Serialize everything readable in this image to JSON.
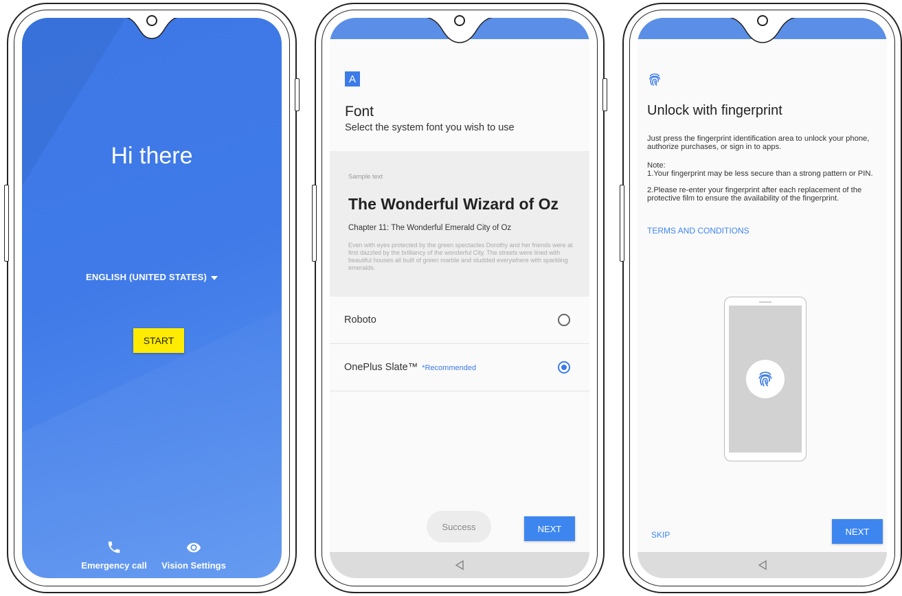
{
  "screen1": {
    "greeting": "Hi there",
    "language": "ENGLISH (UNITED STATES)",
    "start_label": "START",
    "emergency_label": "Emergency call",
    "vision_label": "Vision Settings",
    "icons": [
      "phone-icon",
      "eye-icon",
      "chevron-down-icon"
    ]
  },
  "screen2": {
    "icon_letter": "A",
    "title": "Font",
    "subtitle": "Select the system font you wish to use",
    "sample": {
      "label": "Sample text",
      "title": "The Wonderful Wizard of Oz",
      "chapter": "Chapter 11: The Wonderful Emerald City of Oz",
      "body": "Even with eyes protected by the green spectacles Dorothy and her friends were at first dazzled by the brilliancy of the wonderful City. The streets were lined with beautiful houses all built of green marble and studded everywhere with sparkling emeralds."
    },
    "options": [
      {
        "label": "Roboto",
        "tag": "",
        "selected": false
      },
      {
        "label": "OnePlus Slate™",
        "tag": "*Recommended",
        "selected": true
      }
    ],
    "toast": "Success",
    "next_label": "NEXT"
  },
  "screen3": {
    "title": "Unlock with fingerprint",
    "intro": "Just press the fingerprint identification area to unlock your phone, authorize purchases, or sign in to apps.",
    "note_heading": "Note:",
    "note1": "1.Your fingerprint may be less secure than a strong pattern or PIN.",
    "note2": "2.Please re-enter your fingerprint after each replacement of the protective film to ensure the availability of the fingerprint.",
    "terms": "TERMS AND CONDITIONS",
    "skip_label": "SKIP",
    "next_label": "NEXT"
  },
  "colors": {
    "accent_blue": "#3d86f0",
    "start_yellow": "#ffeb00",
    "welcome_gradient": "#3f7ae8"
  }
}
